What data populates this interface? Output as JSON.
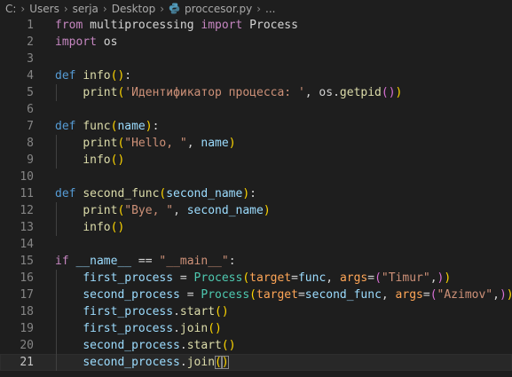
{
  "breadcrumb": {
    "items": [
      "C:",
      "Users",
      "serja",
      "Desktop"
    ],
    "file": "proccesor.py",
    "ellipsis": "..."
  },
  "editor": {
    "active_line": 21,
    "lines": [
      {
        "n": "1",
        "tokens": [
          [
            "kw",
            "from"
          ],
          [
            "op",
            " multiprocessing "
          ],
          [
            "kw",
            "import"
          ],
          [
            "op",
            " Process"
          ]
        ]
      },
      {
        "n": "2",
        "tokens": [
          [
            "kw",
            "import"
          ],
          [
            "op",
            " os"
          ]
        ]
      },
      {
        "n": "3",
        "tokens": []
      },
      {
        "n": "4",
        "tokens": [
          [
            "def",
            "def"
          ],
          [
            "op",
            " "
          ],
          [
            "fn",
            "info"
          ],
          [
            "p1",
            "("
          ],
          [
            "p1",
            ")"
          ],
          [
            "op",
            ":"
          ]
        ]
      },
      {
        "n": "5",
        "tokens": [
          [
            "op",
            "    "
          ],
          [
            "fn",
            "print"
          ],
          [
            "p1",
            "("
          ],
          [
            "str",
            "'Идентификатор процесса: '"
          ],
          [
            "op",
            ", os."
          ],
          [
            "fn",
            "getpid"
          ],
          [
            "p2",
            "("
          ],
          [
            "p2",
            ")"
          ],
          [
            "p1",
            ")"
          ]
        ]
      },
      {
        "n": "6",
        "tokens": []
      },
      {
        "n": "7",
        "tokens": [
          [
            "def",
            "def"
          ],
          [
            "op",
            " "
          ],
          [
            "fn",
            "func"
          ],
          [
            "p1",
            "("
          ],
          [
            "var",
            "name"
          ],
          [
            "p1",
            ")"
          ],
          [
            "op",
            ":"
          ]
        ]
      },
      {
        "n": "8",
        "tokens": [
          [
            "op",
            "    "
          ],
          [
            "fn",
            "print"
          ],
          [
            "p1",
            "("
          ],
          [
            "str",
            "\"Hello, \""
          ],
          [
            "op",
            ", "
          ],
          [
            "var",
            "name"
          ],
          [
            "p1",
            ")"
          ]
        ]
      },
      {
        "n": "9",
        "tokens": [
          [
            "op",
            "    "
          ],
          [
            "fn",
            "info"
          ],
          [
            "p1",
            "("
          ],
          [
            "p1",
            ")"
          ]
        ]
      },
      {
        "n": "10",
        "tokens": []
      },
      {
        "n": "11",
        "tokens": [
          [
            "def",
            "def"
          ],
          [
            "op",
            " "
          ],
          [
            "fn",
            "second_func"
          ],
          [
            "p1",
            "("
          ],
          [
            "var",
            "second_name"
          ],
          [
            "p1",
            ")"
          ],
          [
            "op",
            ":"
          ]
        ]
      },
      {
        "n": "12",
        "tokens": [
          [
            "op",
            "    "
          ],
          [
            "fn",
            "print"
          ],
          [
            "p1",
            "("
          ],
          [
            "str",
            "\"Bye, \""
          ],
          [
            "op",
            ", "
          ],
          [
            "var",
            "second_name"
          ],
          [
            "p1",
            ")"
          ]
        ]
      },
      {
        "n": "13",
        "tokens": [
          [
            "op",
            "    "
          ],
          [
            "fn",
            "info"
          ],
          [
            "p1",
            "("
          ],
          [
            "p1",
            ")"
          ]
        ]
      },
      {
        "n": "14",
        "tokens": []
      },
      {
        "n": "15",
        "tokens": [
          [
            "kw",
            "if"
          ],
          [
            "op",
            " "
          ],
          [
            "var",
            "__name__"
          ],
          [
            "op",
            " == "
          ],
          [
            "str",
            "\"__main__\""
          ],
          [
            "op",
            ":"
          ]
        ]
      },
      {
        "n": "16",
        "tokens": [
          [
            "op",
            "    "
          ],
          [
            "var",
            "first_process"
          ],
          [
            "op",
            " = "
          ],
          [
            "cls",
            "Process"
          ],
          [
            "p1",
            "("
          ],
          [
            "kwarg",
            "target"
          ],
          [
            "op",
            "="
          ],
          [
            "var",
            "func"
          ],
          [
            "op",
            ", "
          ],
          [
            "kwarg",
            "args"
          ],
          [
            "op",
            "="
          ],
          [
            "p2",
            "("
          ],
          [
            "str",
            "\"Timur\""
          ],
          [
            "op",
            ","
          ],
          [
            "p2",
            ")"
          ],
          [
            "p1",
            ")"
          ]
        ]
      },
      {
        "n": "17",
        "tokens": [
          [
            "op",
            "    "
          ],
          [
            "var",
            "second_process"
          ],
          [
            "op",
            " = "
          ],
          [
            "cls",
            "Process"
          ],
          [
            "p1",
            "("
          ],
          [
            "kwarg",
            "target"
          ],
          [
            "op",
            "="
          ],
          [
            "var",
            "second_func"
          ],
          [
            "op",
            ", "
          ],
          [
            "kwarg",
            "args"
          ],
          [
            "op",
            "="
          ],
          [
            "p2",
            "("
          ],
          [
            "str",
            "\"Azimov\""
          ],
          [
            "op",
            ","
          ],
          [
            "p2",
            ")"
          ],
          [
            "p1",
            ")"
          ]
        ]
      },
      {
        "n": "18",
        "tokens": [
          [
            "op",
            "    "
          ],
          [
            "var",
            "first_process"
          ],
          [
            "op",
            "."
          ],
          [
            "fn",
            "start"
          ],
          [
            "p1",
            "("
          ],
          [
            "p1",
            ")"
          ]
        ]
      },
      {
        "n": "19",
        "tokens": [
          [
            "op",
            "    "
          ],
          [
            "var",
            "first_process"
          ],
          [
            "op",
            "."
          ],
          [
            "fn",
            "join"
          ],
          [
            "p1",
            "("
          ],
          [
            "p1",
            ")"
          ]
        ]
      },
      {
        "n": "20",
        "tokens": [
          [
            "op",
            "    "
          ],
          [
            "var",
            "second_process"
          ],
          [
            "op",
            "."
          ],
          [
            "fn",
            "start"
          ],
          [
            "p1",
            "("
          ],
          [
            "p1",
            ")"
          ]
        ]
      },
      {
        "n": "21",
        "tokens": [
          [
            "op",
            "    "
          ],
          [
            "var",
            "second_process"
          ],
          [
            "op",
            "."
          ],
          [
            "fn",
            "join"
          ],
          [
            "p1",
            "("
          ],
          [
            "p1",
            ")"
          ]
        ]
      }
    ]
  }
}
